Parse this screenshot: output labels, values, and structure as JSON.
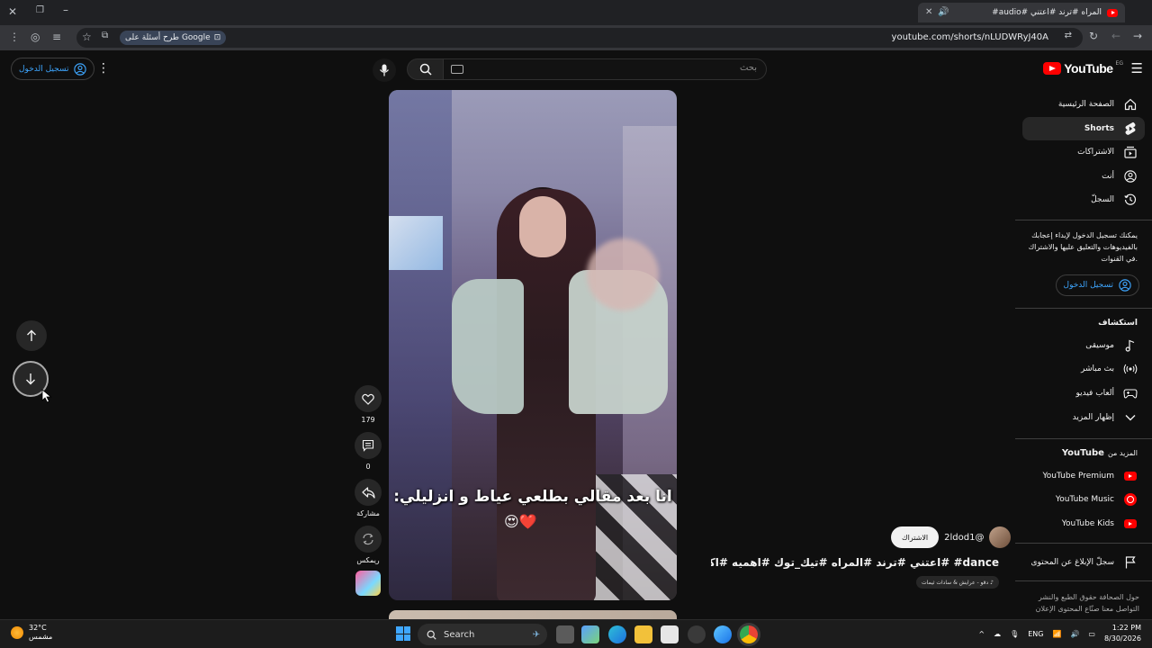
{
  "browser": {
    "tab_title": "المراه #ترند #اعتني #audio#",
    "url": "youtube.com/shorts/nLUDWRyJ40A",
    "google_chip": "طرح أسئلة على Google"
  },
  "header": {
    "logo_text": "YouTube",
    "country_code": "EG",
    "search_placeholder": "بحث",
    "signin_label": "تسجيل الدخول"
  },
  "sidebar": {
    "nav": [
      {
        "label": "الصفحة الرئيسية",
        "icon": "home-icon"
      },
      {
        "label": "Shorts",
        "icon": "shorts-icon",
        "active": true
      },
      {
        "label": "الاشتراكات",
        "icon": "subscriptions-icon"
      },
      {
        "label": "أنت",
        "icon": "you-icon"
      },
      {
        "label": "السجلّ",
        "icon": "history-icon"
      }
    ],
    "signin_note": "يمكنك تسجيل الدخول لإبداء إعجابك بالفيديوهات والتعليق عليها والاشتراك في القنوات.",
    "signin_label": "تسجيل الدخول",
    "explore_heading": "استكشاف",
    "explore": [
      {
        "label": "موسيقى",
        "icon": "music-icon"
      },
      {
        "label": "بث مباشر",
        "icon": "live-icon"
      },
      {
        "label": "ألعاب فيديو",
        "icon": "gaming-icon"
      },
      {
        "label": "إظهار المزيد",
        "icon": "chevron-down-icon"
      }
    ],
    "more_heading_prefix": "المزيد من",
    "more_heading_brand": "YouTube",
    "more": [
      {
        "label": "YouTube Premium"
      },
      {
        "label": "YouTube Music"
      },
      {
        "label": "YouTube Kids"
      }
    ],
    "report_label": "سجلّ الإبلاغ عن المحتوى",
    "footer": "حول  الصحافة  حقوق الطبع والنشر  التواصل معنا  صنّاع المحتوى  الإعلان"
  },
  "short": {
    "caption": "انا بعد مقالي بطلعي عياط و انزليلي:",
    "caption_emoji": "😍❤️",
    "likes": "179",
    "comments": "0",
    "share_label": "مشاركة",
    "remix_label": "ريمكس",
    "channel": "@2ldod1",
    "subscribe_label": "الاشتراك",
    "title": "dance# #اعتني #ترند #المراه #تيك_توك #اهميه #اكسبلور audio...",
    "audio_chip": "♪ دقو - عرايش & سادات ثيمات"
  },
  "taskbar": {
    "weather_temp": "32°C",
    "weather_desc": "مشمس",
    "search_label": "Search",
    "lang": "ENG",
    "time": "1:22 PM",
    "date": "8/30/2026"
  },
  "colors": {
    "accent_blue": "#3ea6ff",
    "brand_red": "#ff0000",
    "background": "#0f0f0f"
  }
}
